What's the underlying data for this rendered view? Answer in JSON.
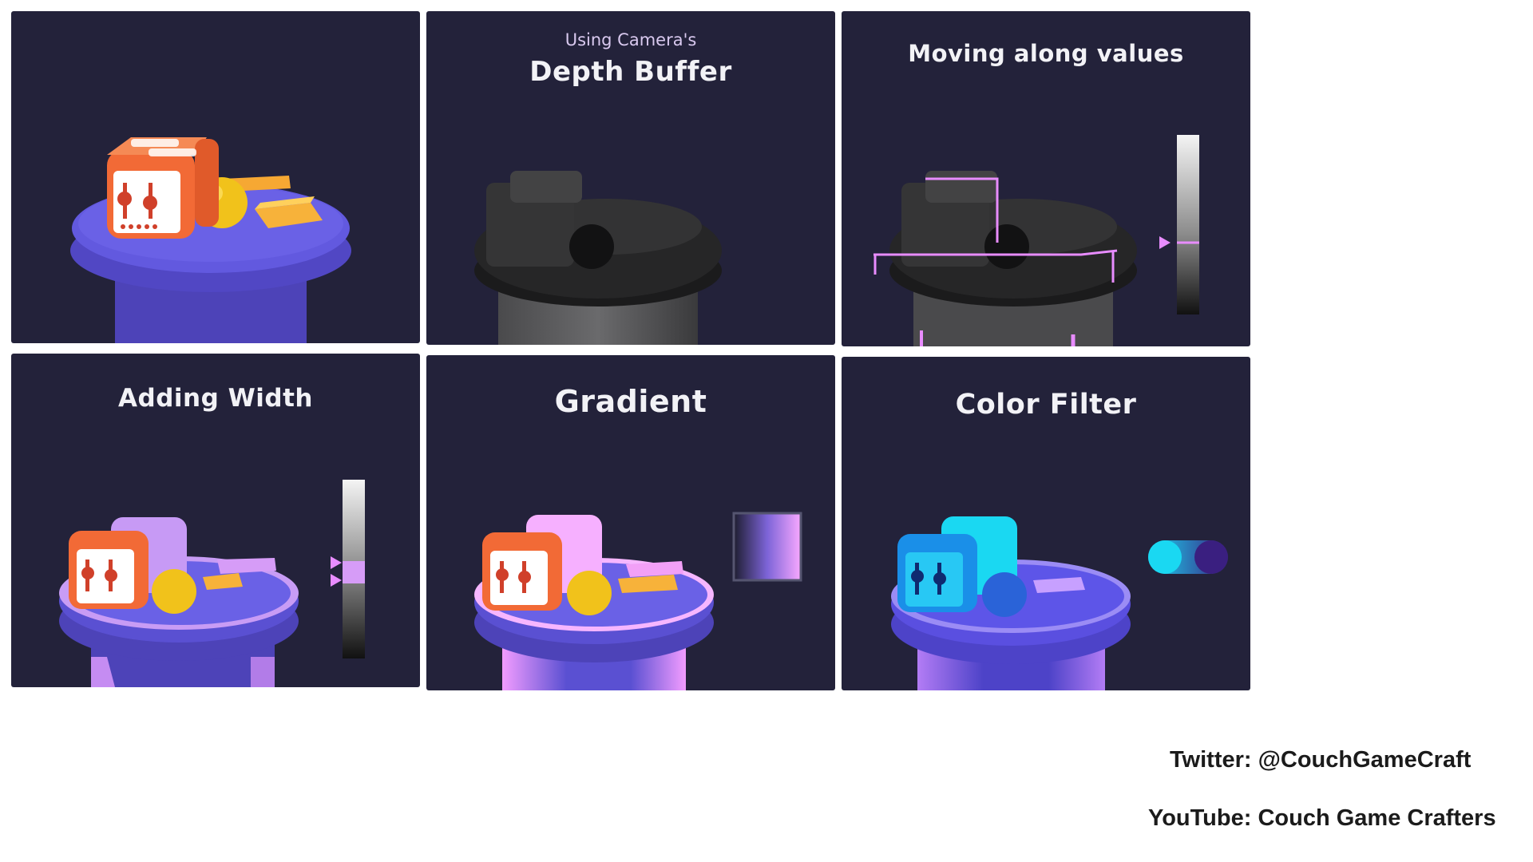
{
  "panels": [
    {
      "subtitle": "",
      "title": ""
    },
    {
      "subtitle": "Using Camera's",
      "title": "Depth Buffer"
    },
    {
      "subtitle": "",
      "title": "Moving along values"
    },
    {
      "subtitle": "",
      "title": "Adding Width"
    },
    {
      "subtitle": "",
      "title": "Gradient"
    },
    {
      "subtitle": "",
      "title": "Color Filter"
    }
  ],
  "credits": {
    "twitter": "Twitter: @CouchGameCraft",
    "youtube": "YouTube: Couch Game Crafters"
  },
  "colors": {
    "panel_bg": "#23223a",
    "pedestal_purple": "#5a4fd0",
    "toaster_orange": "#f26a36",
    "ball_yellow": "#f1c21b",
    "glow_pink": "#e88cff",
    "filter_cyan": "#1ad8f2"
  },
  "icons": [
    "toaster-icon",
    "ball-icon",
    "pedestal-icon",
    "depth-gradient-bar-icon",
    "marker-triangle-icon",
    "gradient-swatch-icon",
    "color-toggle-icon"
  ]
}
